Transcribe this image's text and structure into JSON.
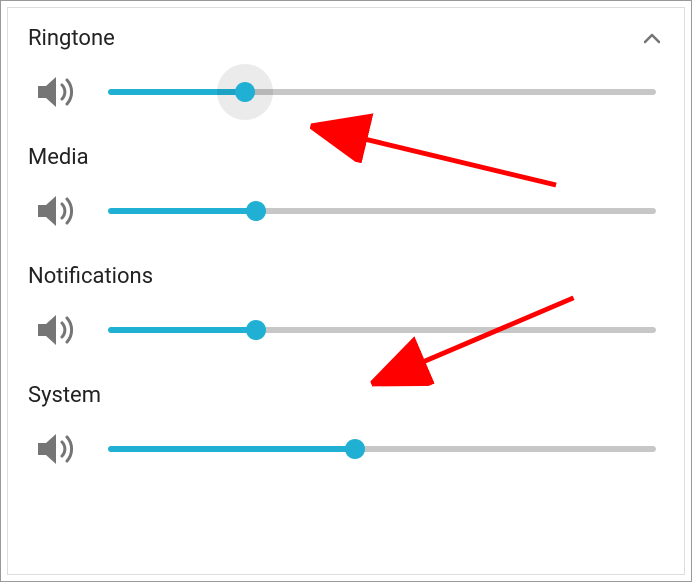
{
  "accent_color": "#1fb0d3",
  "arrow_color": "#ff0000",
  "sections": {
    "ringtone": {
      "label": "Ringtone",
      "value_percent": 25,
      "halo": true,
      "expanded": true
    },
    "media": {
      "label": "Media",
      "value_percent": 27,
      "halo": false
    },
    "notifications": {
      "label": "Notifications",
      "value_percent": 27,
      "halo": false
    },
    "system": {
      "label": "System",
      "value_percent": 45,
      "halo": false
    }
  }
}
